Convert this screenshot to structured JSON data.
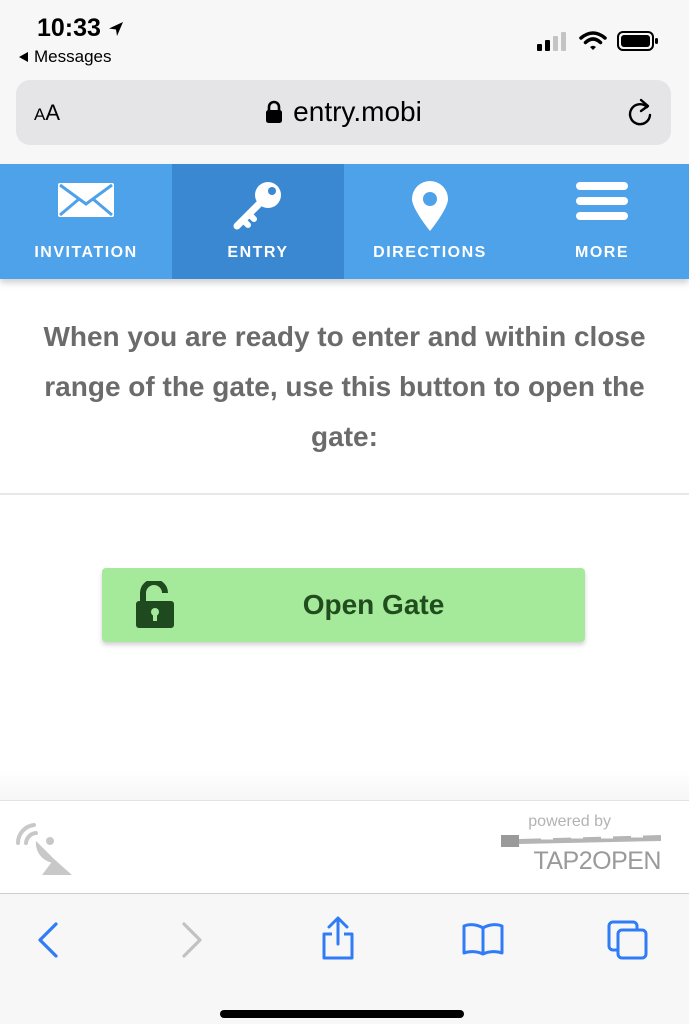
{
  "status_bar": {
    "time": "10:33",
    "back_label": "Messages"
  },
  "browser": {
    "aa_label_small": "A",
    "aa_label_large": "A",
    "url": "entry.mobi"
  },
  "nav": {
    "items": [
      {
        "label": "INVITATION",
        "icon": "envelope-icon",
        "active": false
      },
      {
        "label": "ENTRY",
        "icon": "key-icon",
        "active": true
      },
      {
        "label": "DIRECTIONS",
        "icon": "map-pin-icon",
        "active": false
      },
      {
        "label": "MORE",
        "icon": "hamburger-menu-icon",
        "active": false
      }
    ]
  },
  "main": {
    "intro_text": "When you are ready to enter and within close range of the gate, use this button to open the gate:",
    "open_gate_label": "Open Gate"
  },
  "footer": {
    "powered_by": "powered by",
    "brand": "TAP2OPEN"
  },
  "colors": {
    "nav_bg": "#4da2ea",
    "nav_active": "#3a88d1",
    "button_bg": "#a5e99a",
    "button_text": "#214d1e",
    "ios_blue": "#2f7cf6"
  }
}
